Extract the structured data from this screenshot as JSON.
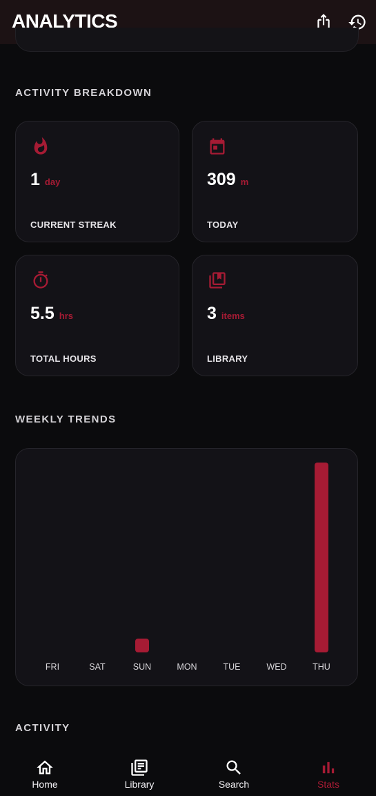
{
  "header": {
    "title": "ANALYTICS",
    "share_icon": "share-icon",
    "history_icon": "history-icon"
  },
  "sections": {
    "activity_breakdown": "ACTIVITY BREAKDOWN",
    "weekly_trends": "WEEKLY TRENDS",
    "activity": "ACTIVITY"
  },
  "stats": [
    {
      "icon": "fire-icon",
      "value": "1",
      "unit": "day",
      "label": "CURRENT STREAK"
    },
    {
      "icon": "calendar-icon",
      "value": "309",
      "unit": "m",
      "label": "TODAY"
    },
    {
      "icon": "stopwatch-icon",
      "value": "5.5",
      "unit": "hrs",
      "label": "TOTAL HOURS"
    },
    {
      "icon": "library-books-icon",
      "value": "3",
      "unit": "items",
      "label": "LIBRARY"
    }
  ],
  "chart_data": {
    "type": "bar",
    "categories": [
      "FRI",
      "SAT",
      "SUN",
      "MON",
      "TUE",
      "WED",
      "THU"
    ],
    "values": [
      0,
      0,
      6,
      0,
      0,
      0,
      309
    ],
    "ylim": [
      0,
      309
    ],
    "grid": false,
    "bar_color": "#a61b34"
  },
  "nav": {
    "items": [
      {
        "icon": "home-icon",
        "label": "Home"
      },
      {
        "icon": "library-icon",
        "label": "Library"
      },
      {
        "icon": "search-icon",
        "label": "Search"
      },
      {
        "icon": "bar-chart-icon",
        "label": "Stats"
      }
    ],
    "active": "Stats"
  },
  "colors": {
    "accent": "#a61b34",
    "background": "#0b0b0d",
    "card": "#131217",
    "header": "#1c1214"
  }
}
